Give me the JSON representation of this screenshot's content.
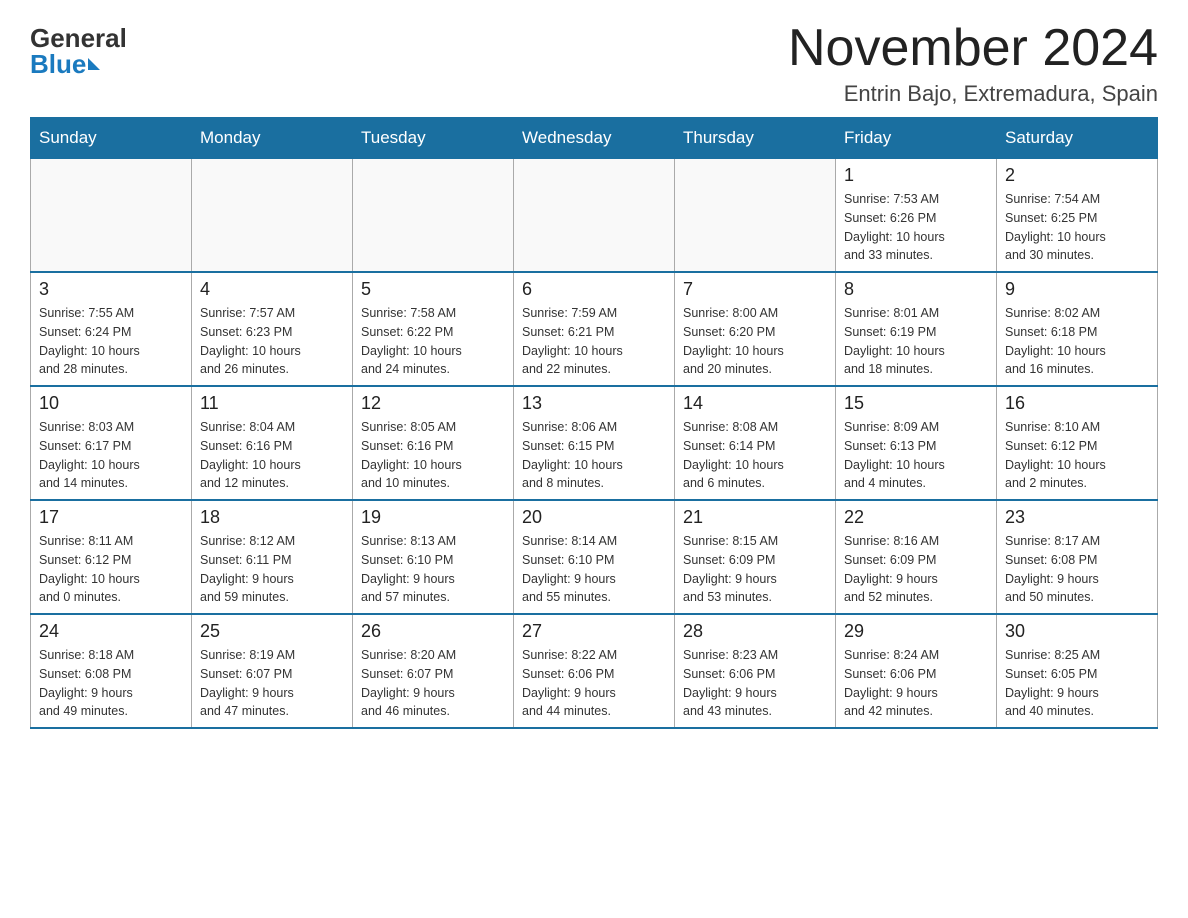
{
  "logo": {
    "general": "General",
    "blue": "Blue"
  },
  "title": "November 2024",
  "subtitle": "Entrin Bajo, Extremadura, Spain",
  "weekdays": [
    "Sunday",
    "Monday",
    "Tuesday",
    "Wednesday",
    "Thursday",
    "Friday",
    "Saturday"
  ],
  "weeks": [
    [
      {
        "day": "",
        "info": ""
      },
      {
        "day": "",
        "info": ""
      },
      {
        "day": "",
        "info": ""
      },
      {
        "day": "",
        "info": ""
      },
      {
        "day": "",
        "info": ""
      },
      {
        "day": "1",
        "info": "Sunrise: 7:53 AM\nSunset: 6:26 PM\nDaylight: 10 hours\nand 33 minutes."
      },
      {
        "day": "2",
        "info": "Sunrise: 7:54 AM\nSunset: 6:25 PM\nDaylight: 10 hours\nand 30 minutes."
      }
    ],
    [
      {
        "day": "3",
        "info": "Sunrise: 7:55 AM\nSunset: 6:24 PM\nDaylight: 10 hours\nand 28 minutes."
      },
      {
        "day": "4",
        "info": "Sunrise: 7:57 AM\nSunset: 6:23 PM\nDaylight: 10 hours\nand 26 minutes."
      },
      {
        "day": "5",
        "info": "Sunrise: 7:58 AM\nSunset: 6:22 PM\nDaylight: 10 hours\nand 24 minutes."
      },
      {
        "day": "6",
        "info": "Sunrise: 7:59 AM\nSunset: 6:21 PM\nDaylight: 10 hours\nand 22 minutes."
      },
      {
        "day": "7",
        "info": "Sunrise: 8:00 AM\nSunset: 6:20 PM\nDaylight: 10 hours\nand 20 minutes."
      },
      {
        "day": "8",
        "info": "Sunrise: 8:01 AM\nSunset: 6:19 PM\nDaylight: 10 hours\nand 18 minutes."
      },
      {
        "day": "9",
        "info": "Sunrise: 8:02 AM\nSunset: 6:18 PM\nDaylight: 10 hours\nand 16 minutes."
      }
    ],
    [
      {
        "day": "10",
        "info": "Sunrise: 8:03 AM\nSunset: 6:17 PM\nDaylight: 10 hours\nand 14 minutes."
      },
      {
        "day": "11",
        "info": "Sunrise: 8:04 AM\nSunset: 6:16 PM\nDaylight: 10 hours\nand 12 minutes."
      },
      {
        "day": "12",
        "info": "Sunrise: 8:05 AM\nSunset: 6:16 PM\nDaylight: 10 hours\nand 10 minutes."
      },
      {
        "day": "13",
        "info": "Sunrise: 8:06 AM\nSunset: 6:15 PM\nDaylight: 10 hours\nand 8 minutes."
      },
      {
        "day": "14",
        "info": "Sunrise: 8:08 AM\nSunset: 6:14 PM\nDaylight: 10 hours\nand 6 minutes."
      },
      {
        "day": "15",
        "info": "Sunrise: 8:09 AM\nSunset: 6:13 PM\nDaylight: 10 hours\nand 4 minutes."
      },
      {
        "day": "16",
        "info": "Sunrise: 8:10 AM\nSunset: 6:12 PM\nDaylight: 10 hours\nand 2 minutes."
      }
    ],
    [
      {
        "day": "17",
        "info": "Sunrise: 8:11 AM\nSunset: 6:12 PM\nDaylight: 10 hours\nand 0 minutes."
      },
      {
        "day": "18",
        "info": "Sunrise: 8:12 AM\nSunset: 6:11 PM\nDaylight: 9 hours\nand 59 minutes."
      },
      {
        "day": "19",
        "info": "Sunrise: 8:13 AM\nSunset: 6:10 PM\nDaylight: 9 hours\nand 57 minutes."
      },
      {
        "day": "20",
        "info": "Sunrise: 8:14 AM\nSunset: 6:10 PM\nDaylight: 9 hours\nand 55 minutes."
      },
      {
        "day": "21",
        "info": "Sunrise: 8:15 AM\nSunset: 6:09 PM\nDaylight: 9 hours\nand 53 minutes."
      },
      {
        "day": "22",
        "info": "Sunrise: 8:16 AM\nSunset: 6:09 PM\nDaylight: 9 hours\nand 52 minutes."
      },
      {
        "day": "23",
        "info": "Sunrise: 8:17 AM\nSunset: 6:08 PM\nDaylight: 9 hours\nand 50 minutes."
      }
    ],
    [
      {
        "day": "24",
        "info": "Sunrise: 8:18 AM\nSunset: 6:08 PM\nDaylight: 9 hours\nand 49 minutes."
      },
      {
        "day": "25",
        "info": "Sunrise: 8:19 AM\nSunset: 6:07 PM\nDaylight: 9 hours\nand 47 minutes."
      },
      {
        "day": "26",
        "info": "Sunrise: 8:20 AM\nSunset: 6:07 PM\nDaylight: 9 hours\nand 46 minutes."
      },
      {
        "day": "27",
        "info": "Sunrise: 8:22 AM\nSunset: 6:06 PM\nDaylight: 9 hours\nand 44 minutes."
      },
      {
        "day": "28",
        "info": "Sunrise: 8:23 AM\nSunset: 6:06 PM\nDaylight: 9 hours\nand 43 minutes."
      },
      {
        "day": "29",
        "info": "Sunrise: 8:24 AM\nSunset: 6:06 PM\nDaylight: 9 hours\nand 42 minutes."
      },
      {
        "day": "30",
        "info": "Sunrise: 8:25 AM\nSunset: 6:05 PM\nDaylight: 9 hours\nand 40 minutes."
      }
    ]
  ]
}
